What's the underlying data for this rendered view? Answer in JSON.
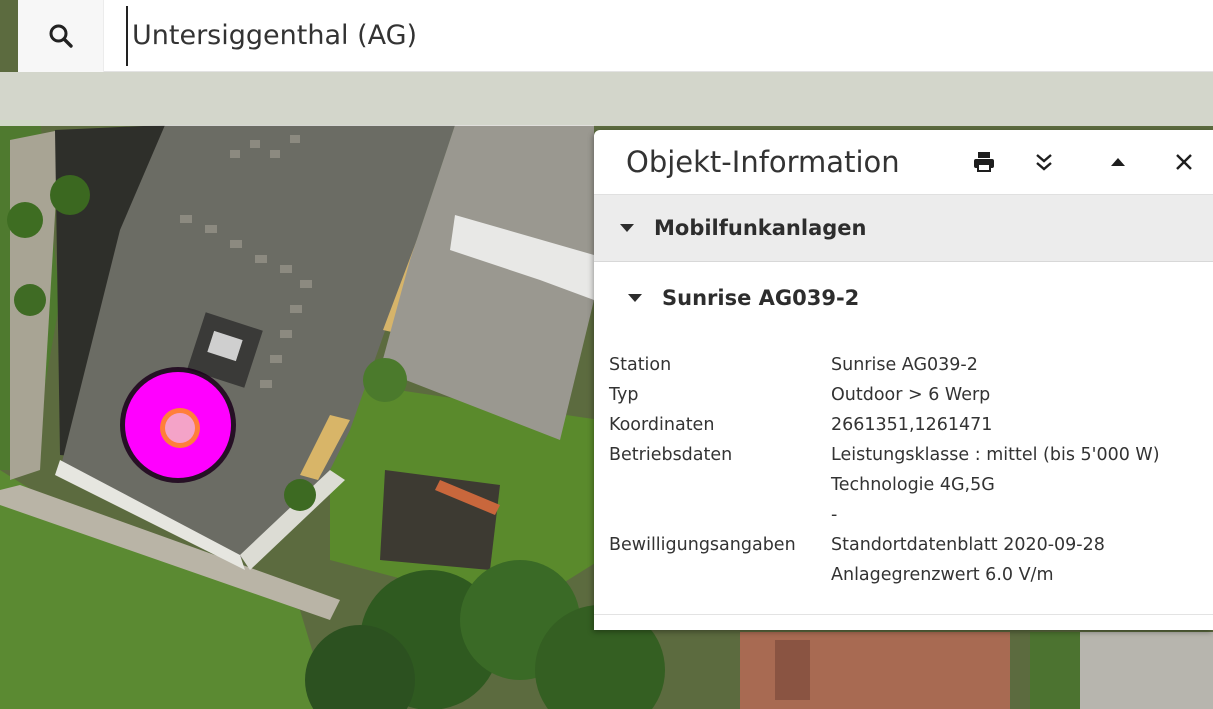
{
  "search": {
    "value": "Untersiggenthal (AG)",
    "icon": "search-icon"
  },
  "panel": {
    "title": "Objekt-Information",
    "actions": [
      {
        "name": "print-icon"
      },
      {
        "name": "double-chevron-down-icon"
      },
      {
        "name": "caret-up-icon"
      },
      {
        "name": "close-icon"
      }
    ],
    "section": {
      "label": "Mobilfunkanlagen",
      "item": {
        "label": "Sunrise AG039-2",
        "attributes": [
          {
            "key": "Station",
            "values": [
              "Sunrise AG039-2"
            ]
          },
          {
            "key": "Typ",
            "values": [
              "Outdoor > 6 Werp"
            ]
          },
          {
            "key": "Koordinaten",
            "values": [
              "2661351,1261471"
            ]
          },
          {
            "key": "Betriebsdaten",
            "values": [
              "Leistungsklasse : mittel (bis 5'000 W)",
              "Technologie 4G,5G",
              "-"
            ]
          },
          {
            "key": "Bewilligungsangaben",
            "values": [
              "Standortdatenblatt 2020-09-28",
              "Anlagegrenzwert 6.0 V/m"
            ]
          }
        ]
      }
    }
  },
  "map": {
    "marker_color": "#ff00ff",
    "marker_center_color": "#f4a3c8",
    "marker_ring_color": "#ff7f3a"
  }
}
